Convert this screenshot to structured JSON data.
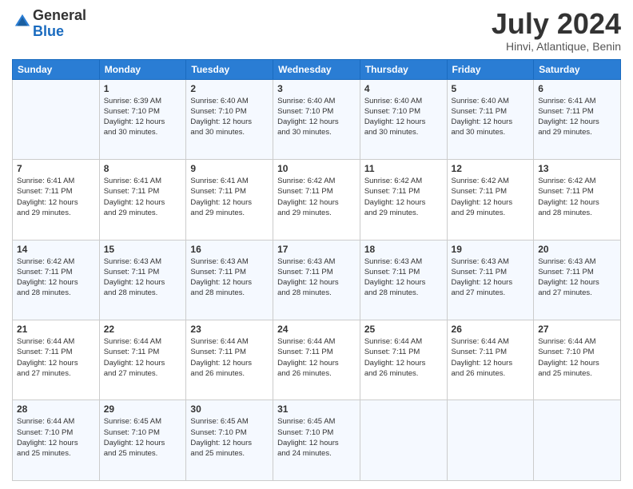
{
  "logo": {
    "general": "General",
    "blue": "Blue"
  },
  "header": {
    "month": "July 2024",
    "location": "Hinvi, Atlantique, Benin"
  },
  "days_of_week": [
    "Sunday",
    "Monday",
    "Tuesday",
    "Wednesday",
    "Thursday",
    "Friday",
    "Saturday"
  ],
  "weeks": [
    [
      {
        "day": "",
        "info": ""
      },
      {
        "day": "1",
        "info": "Sunrise: 6:39 AM\nSunset: 7:10 PM\nDaylight: 12 hours\nand 30 minutes."
      },
      {
        "day": "2",
        "info": "Sunrise: 6:40 AM\nSunset: 7:10 PM\nDaylight: 12 hours\nand 30 minutes."
      },
      {
        "day": "3",
        "info": "Sunrise: 6:40 AM\nSunset: 7:10 PM\nDaylight: 12 hours\nand 30 minutes."
      },
      {
        "day": "4",
        "info": "Sunrise: 6:40 AM\nSunset: 7:10 PM\nDaylight: 12 hours\nand 30 minutes."
      },
      {
        "day": "5",
        "info": "Sunrise: 6:40 AM\nSunset: 7:11 PM\nDaylight: 12 hours\nand 30 minutes."
      },
      {
        "day": "6",
        "info": "Sunrise: 6:41 AM\nSunset: 7:11 PM\nDaylight: 12 hours\nand 29 minutes."
      }
    ],
    [
      {
        "day": "7",
        "info": "Sunrise: 6:41 AM\nSunset: 7:11 PM\nDaylight: 12 hours\nand 29 minutes."
      },
      {
        "day": "8",
        "info": "Sunrise: 6:41 AM\nSunset: 7:11 PM\nDaylight: 12 hours\nand 29 minutes."
      },
      {
        "day": "9",
        "info": "Sunrise: 6:41 AM\nSunset: 7:11 PM\nDaylight: 12 hours\nand 29 minutes."
      },
      {
        "day": "10",
        "info": "Sunrise: 6:42 AM\nSunset: 7:11 PM\nDaylight: 12 hours\nand 29 minutes."
      },
      {
        "day": "11",
        "info": "Sunrise: 6:42 AM\nSunset: 7:11 PM\nDaylight: 12 hours\nand 29 minutes."
      },
      {
        "day": "12",
        "info": "Sunrise: 6:42 AM\nSunset: 7:11 PM\nDaylight: 12 hours\nand 29 minutes."
      },
      {
        "day": "13",
        "info": "Sunrise: 6:42 AM\nSunset: 7:11 PM\nDaylight: 12 hours\nand 28 minutes."
      }
    ],
    [
      {
        "day": "14",
        "info": "Sunrise: 6:42 AM\nSunset: 7:11 PM\nDaylight: 12 hours\nand 28 minutes."
      },
      {
        "day": "15",
        "info": "Sunrise: 6:43 AM\nSunset: 7:11 PM\nDaylight: 12 hours\nand 28 minutes."
      },
      {
        "day": "16",
        "info": "Sunrise: 6:43 AM\nSunset: 7:11 PM\nDaylight: 12 hours\nand 28 minutes."
      },
      {
        "day": "17",
        "info": "Sunrise: 6:43 AM\nSunset: 7:11 PM\nDaylight: 12 hours\nand 28 minutes."
      },
      {
        "day": "18",
        "info": "Sunrise: 6:43 AM\nSunset: 7:11 PM\nDaylight: 12 hours\nand 28 minutes."
      },
      {
        "day": "19",
        "info": "Sunrise: 6:43 AM\nSunset: 7:11 PM\nDaylight: 12 hours\nand 27 minutes."
      },
      {
        "day": "20",
        "info": "Sunrise: 6:43 AM\nSunset: 7:11 PM\nDaylight: 12 hours\nand 27 minutes."
      }
    ],
    [
      {
        "day": "21",
        "info": "Sunrise: 6:44 AM\nSunset: 7:11 PM\nDaylight: 12 hours\nand 27 minutes."
      },
      {
        "day": "22",
        "info": "Sunrise: 6:44 AM\nSunset: 7:11 PM\nDaylight: 12 hours\nand 27 minutes."
      },
      {
        "day": "23",
        "info": "Sunrise: 6:44 AM\nSunset: 7:11 PM\nDaylight: 12 hours\nand 26 minutes."
      },
      {
        "day": "24",
        "info": "Sunrise: 6:44 AM\nSunset: 7:11 PM\nDaylight: 12 hours\nand 26 minutes."
      },
      {
        "day": "25",
        "info": "Sunrise: 6:44 AM\nSunset: 7:11 PM\nDaylight: 12 hours\nand 26 minutes."
      },
      {
        "day": "26",
        "info": "Sunrise: 6:44 AM\nSunset: 7:11 PM\nDaylight: 12 hours\nand 26 minutes."
      },
      {
        "day": "27",
        "info": "Sunrise: 6:44 AM\nSunset: 7:10 PM\nDaylight: 12 hours\nand 25 minutes."
      }
    ],
    [
      {
        "day": "28",
        "info": "Sunrise: 6:44 AM\nSunset: 7:10 PM\nDaylight: 12 hours\nand 25 minutes."
      },
      {
        "day": "29",
        "info": "Sunrise: 6:45 AM\nSunset: 7:10 PM\nDaylight: 12 hours\nand 25 minutes."
      },
      {
        "day": "30",
        "info": "Sunrise: 6:45 AM\nSunset: 7:10 PM\nDaylight: 12 hours\nand 25 minutes."
      },
      {
        "day": "31",
        "info": "Sunrise: 6:45 AM\nSunset: 7:10 PM\nDaylight: 12 hours\nand 24 minutes."
      },
      {
        "day": "",
        "info": ""
      },
      {
        "day": "",
        "info": ""
      },
      {
        "day": "",
        "info": ""
      }
    ]
  ]
}
